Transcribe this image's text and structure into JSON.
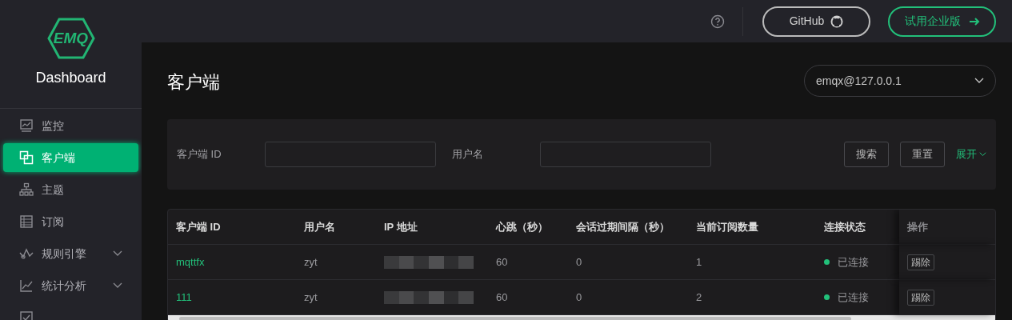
{
  "sidebar": {
    "brand": "EMQ",
    "title": "Dashboard",
    "items": [
      {
        "label": "监控",
        "selected": false,
        "expandable": false
      },
      {
        "label": "客户端",
        "selected": true,
        "expandable": false
      },
      {
        "label": "主题",
        "selected": false,
        "expandable": false
      },
      {
        "label": "订阅",
        "selected": false,
        "expandable": false
      },
      {
        "label": "规则引擎",
        "selected": false,
        "expandable": true
      },
      {
        "label": "统计分析",
        "selected": false,
        "expandable": true
      },
      {
        "selected": false,
        "expandable": false
      }
    ]
  },
  "header": {
    "github": "GitHub",
    "enterprise": "试用企业版"
  },
  "page": {
    "title": "客户端",
    "node": "emqx@127.0.0.1"
  },
  "filters": {
    "fields": [
      {
        "label": "客户端 ID"
      },
      {
        "label": "用户名"
      }
    ],
    "search": "搜索",
    "reset": "重置",
    "expand": "展开"
  },
  "table": {
    "columns": [
      "客户端 ID",
      "用户名",
      "IP 地址",
      "心跳（秒）",
      "会话过期间隔（秒）",
      "当前订阅数量",
      "连接状态",
      "操作"
    ],
    "rows": [
      {
        "client_id": "mqttfx",
        "username": "zyt",
        "keepalive": "60",
        "expiry": "0",
        "subscriptions": "1",
        "status": "已连接",
        "connected": true,
        "action": "踢除"
      },
      {
        "client_id": "111",
        "username": "zyt",
        "keepalive": "60",
        "expiry": "0",
        "subscriptions": "2",
        "status": "已连接",
        "connected": true,
        "action": "踢除"
      }
    ]
  }
}
